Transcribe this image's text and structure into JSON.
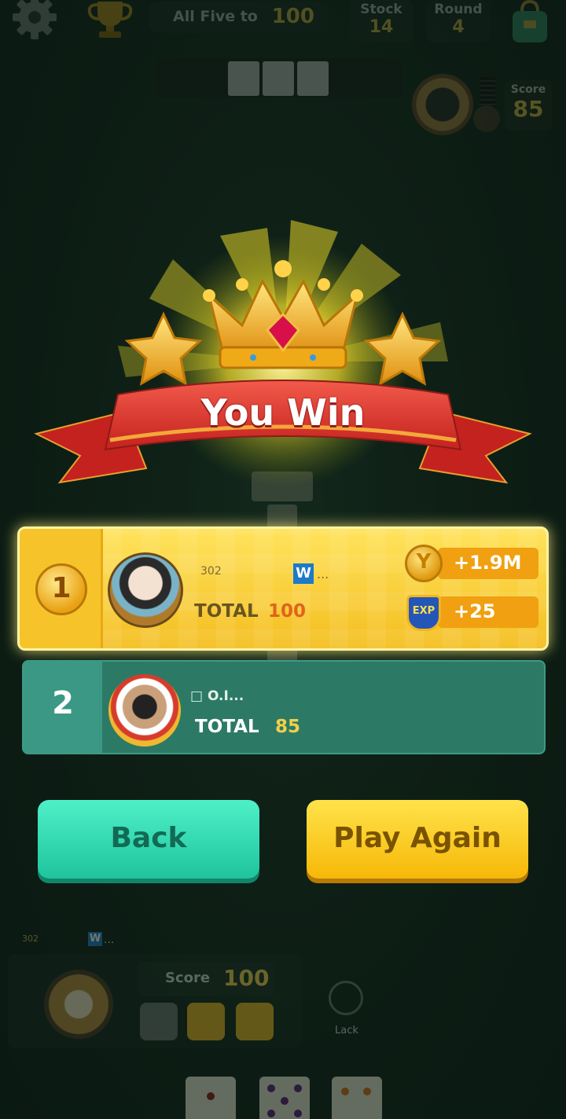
{
  "topbar": {
    "icons": [
      "gear-icon",
      "trophy-icon",
      "bag-icon"
    ],
    "goal_label": "All Five to",
    "goal_value": "100",
    "stock_label": "Stock",
    "stock_value": "14",
    "round_label": "Round",
    "round_value": "4"
  },
  "opponent": {
    "score_label": "Score",
    "score_value": "85"
  },
  "banner": {
    "title": "You Win",
    "colors": {
      "ribbon": "#e23a32",
      "gold": "#f5c02a",
      "glow": "#f2e64a"
    }
  },
  "results": [
    {
      "rank": "1",
      "level": "302",
      "name_badge": "W",
      "name": "...",
      "total_label": "TOTAL",
      "total_value": "100",
      "coins_reward": "+1.9M",
      "exp_label": "EXP",
      "exp_reward": "+25"
    },
    {
      "rank": "2",
      "name": "□ O.I...",
      "total_label": "TOTAL",
      "total_value": "85"
    }
  ],
  "buttons": {
    "back": "Back",
    "play_again": "Play Again"
  },
  "bottom": {
    "level": "302",
    "name_badge": "W",
    "name": "...",
    "score_label": "Score",
    "score_value": "100",
    "lack_label": "Lack"
  },
  "colors": {
    "background": "#142a1f",
    "row1": "#f4be20",
    "row2": "#2c7a66",
    "back_button": "#26d3a8",
    "play_again_button": "#f6c012"
  }
}
